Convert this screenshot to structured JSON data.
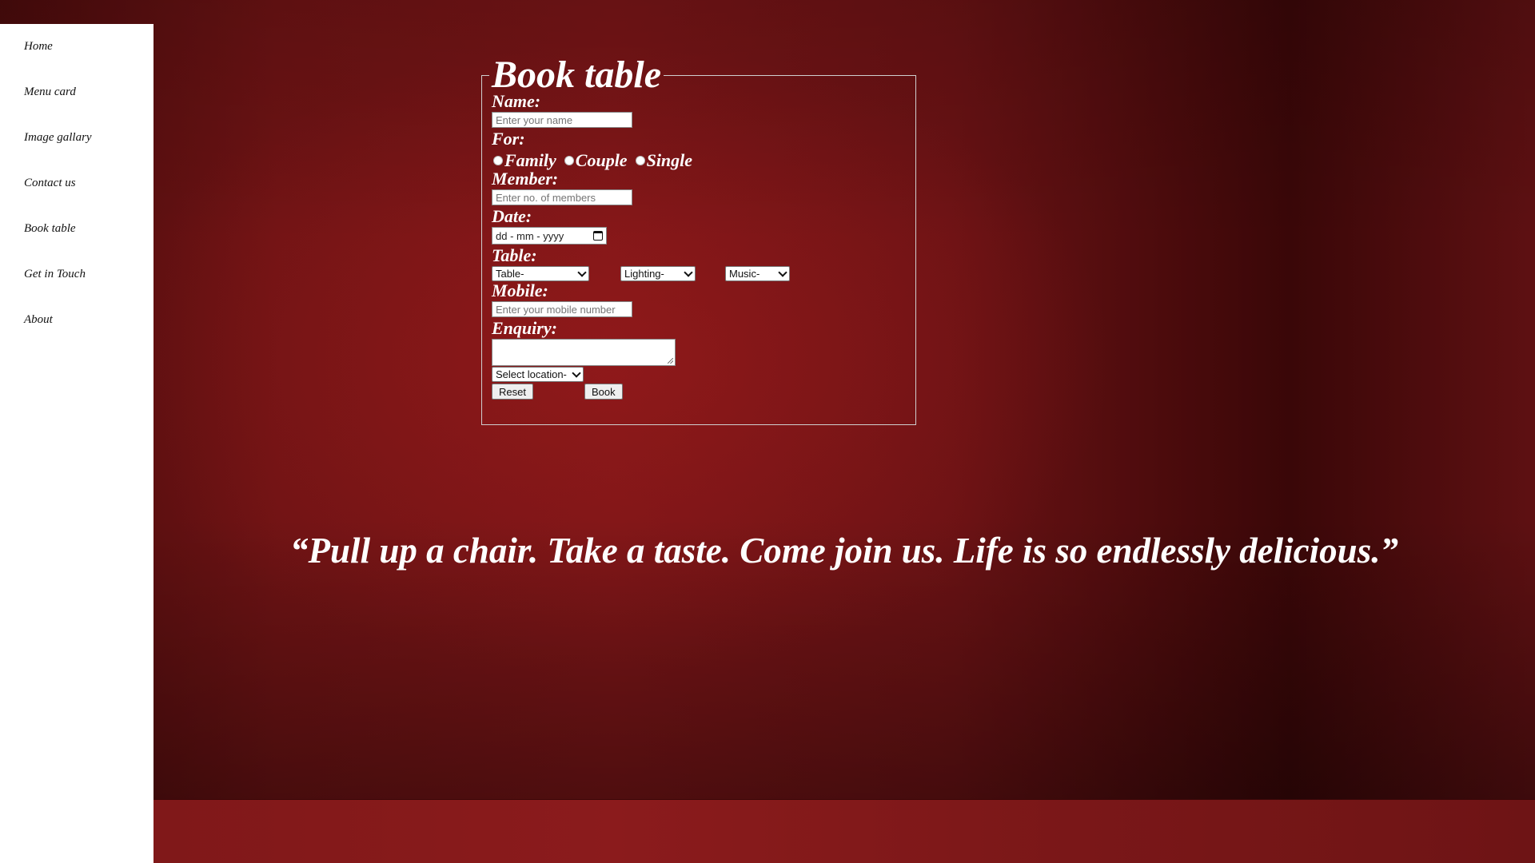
{
  "sidebar": {
    "items": [
      {
        "label": "Home"
      },
      {
        "label": "Menu card"
      },
      {
        "label": "Image gallary"
      },
      {
        "label": "Contact us"
      },
      {
        "label": "Book table"
      },
      {
        "label": "Get in Touch"
      },
      {
        "label": "About"
      }
    ]
  },
  "form": {
    "legend": "Book table",
    "name_label": "Name:",
    "name_placeholder": "Enter your name",
    "for_label": "For:",
    "radio_options": [
      "Family",
      "Couple",
      "Single"
    ],
    "member_label": "Member:",
    "member_placeholder": "Enter no. of members",
    "date_label": "Date:",
    "date_placeholder": "dd - mm - yyyy",
    "table_label": "Table:",
    "table_select": "Table-",
    "lighting_select": "Lighting-",
    "music_select": "Music-",
    "mobile_label": "Mobile:",
    "mobile_placeholder": "Enter your mobile number",
    "enquiry_label": "Enquiry:",
    "location_select": "Select location-",
    "reset_label": "Reset",
    "book_label": "Book"
  },
  "quote": "“Pull up a chair. Take a taste. Come join us. Life is so endlessly delicious.”"
}
